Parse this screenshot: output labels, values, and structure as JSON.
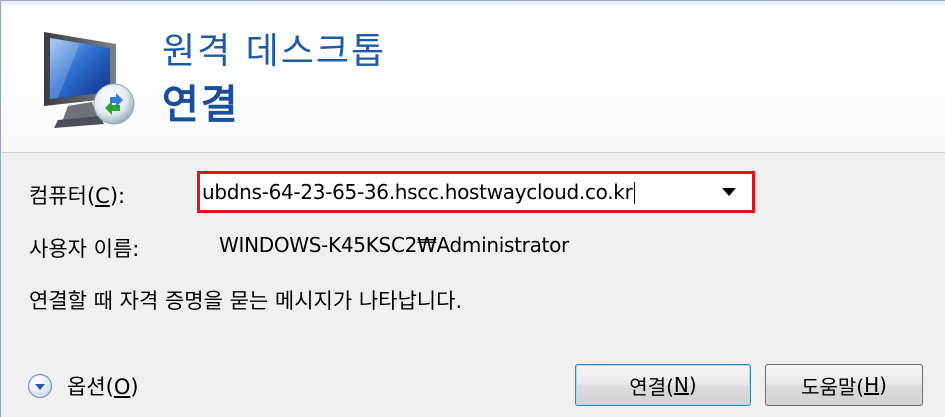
{
  "header": {
    "subtitle": "원격 데스크톱",
    "title": "연결"
  },
  "form": {
    "computer": {
      "label_pre": "컴퓨터(",
      "label_key": "C",
      "label_post": "):",
      "value": "ubdns-64-23-65-36.hscc.hostwaycloud.co.kr"
    },
    "user": {
      "label": "사용자 이름:",
      "value": "WINDOWS-K45KSC2₩Administrator"
    },
    "info": "연결할 때 자격 증명을 묻는 메시지가 나타납니다."
  },
  "footer": {
    "options": {
      "label_pre": "옵션(",
      "label_key": "O",
      "label_post": ")"
    },
    "connect": {
      "label_pre": "연결(",
      "label_key": "N",
      "label_post": ")"
    },
    "help": {
      "label_pre": "도움말(",
      "label_key": "H",
      "label_post": ")"
    }
  },
  "colors": {
    "title": "#1a4e9a",
    "highlight_border": "#e0141e"
  }
}
